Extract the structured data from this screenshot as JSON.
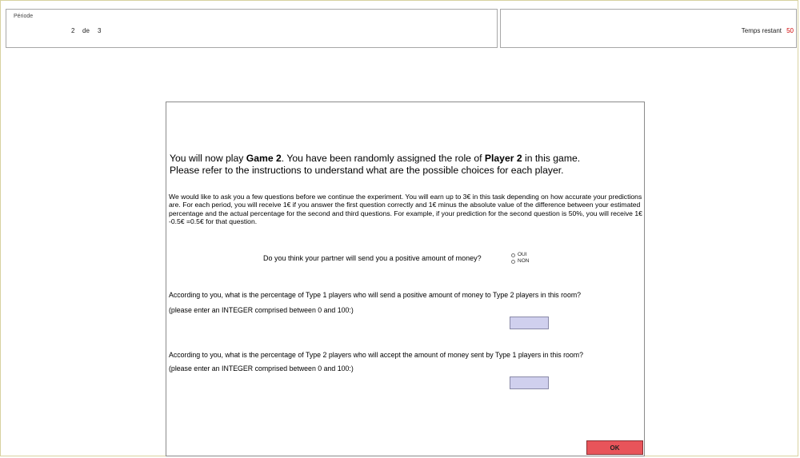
{
  "header": {
    "periode": {
      "legend": "Période",
      "current": "2",
      "separator": "de",
      "total": "3"
    },
    "timer": {
      "label": "Temps restant",
      "value": "50",
      "value_color": "#d00000"
    }
  },
  "main": {
    "intro": {
      "line1_prefix": "You will now play ",
      "game": "Game 2",
      "line1_mid": ". You have been randomly assigned the role of ",
      "role": "Player 2",
      "line1_suffix": " in this game.",
      "line2": "Please refer to the instructions to understand what are the possible choices for each player."
    },
    "description": "We would like to ask you a few questions before we continue the experiment. You will earn up to 3€ in this task depending on how accurate your predictions are. For each period, you will receive 1€ if you answer the first question correctly and 1€ minus the absolute value of the difference between your estimated percentage and the actual percentage for the second and third questions. For example, if your prediction for the second question is 50%, you will receive 1€ -0.5€ =0.5€ for that question.",
    "question1": {
      "text": "Do you think your partner will send you a positive amount of money?",
      "options": [
        "OUI",
        "NON"
      ]
    },
    "question2": {
      "text": "According to you, what is the percentage of Type 1 players who will send a positive amount of money to Type 2 players in this room?",
      "hint": "(please enter an INTEGER comprised between 0 and 100:)",
      "value": ""
    },
    "question3": {
      "text": "According to you, what is the percentage of Type 2 players who will accept the amount of money sent by Type 1 players in this room?",
      "hint": "(please enter an INTEGER comprised between 0 and 100:)",
      "value": ""
    },
    "ok_label": "OK"
  },
  "colors": {
    "input_bg": "#d0d0ee",
    "ok_bg": "#e8545a"
  }
}
